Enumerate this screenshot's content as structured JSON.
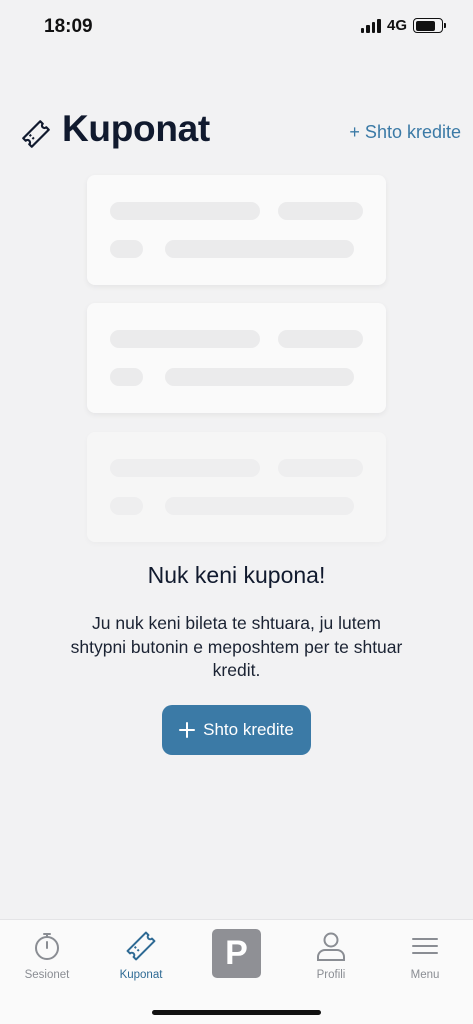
{
  "status_bar": {
    "time": "18:09",
    "network": "4G"
  },
  "header": {
    "title": "Kuponat",
    "add_link": "+ Shto kredite",
    "icon": "ticket-icon"
  },
  "empty_state": {
    "title": "Nuk keni kupona!",
    "description": "Ju nuk keni bileta te shtuara, ju lutem shtypni butonin e meposhtem per te shtuar kredit.",
    "button_label": "Shto kredite"
  },
  "tabs": [
    {
      "label": "Sesionet",
      "icon": "stopwatch-icon",
      "active": false
    },
    {
      "label": "Kuponat",
      "icon": "ticket-icon",
      "active": true
    },
    {
      "label": "P",
      "icon": "parking-icon",
      "active": false
    },
    {
      "label": "Profili",
      "icon": "person-icon",
      "active": false
    },
    {
      "label": "Menu",
      "icon": "menu-icon",
      "active": false
    }
  ],
  "colors": {
    "accent": "#3b7aa6",
    "background": "#f2f2f3",
    "title": "#111a2e"
  }
}
